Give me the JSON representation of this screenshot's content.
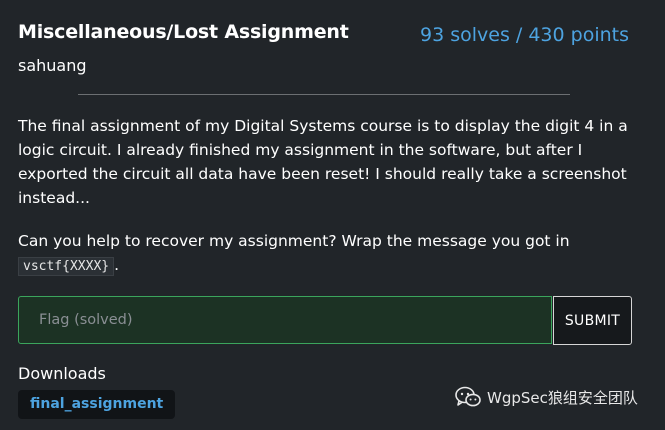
{
  "challenge": {
    "title": "Miscellaneous/Lost Assignment",
    "stats": "93 solves / 430 points",
    "author": "sahuang",
    "description_p1": "The final assignment of my Digital Systems course is to display the digit 4 in a logic circuit. I already finished my assignment in the software, but after I exported the circuit all data have been reset! I should really take a screenshot instead...",
    "description_p2_text": "Can you help to recover my assignment? Wrap the message you got in ",
    "description_p2_code": "vsctf{XXXX}",
    "description_p2_end": "."
  },
  "flag_form": {
    "placeholder": "Flag (solved)",
    "value": "",
    "submit_label": "SUBMIT"
  },
  "downloads": {
    "label": "Downloads",
    "files": [
      "final_assignment"
    ]
  },
  "watermark": {
    "icon": "wechat-icon",
    "text": "WgpSec狼组安全团队"
  },
  "colors": {
    "background": "#212529",
    "accent": "#4da3e0",
    "input_border": "#3ba55c",
    "input_bg": "#1c3224"
  }
}
